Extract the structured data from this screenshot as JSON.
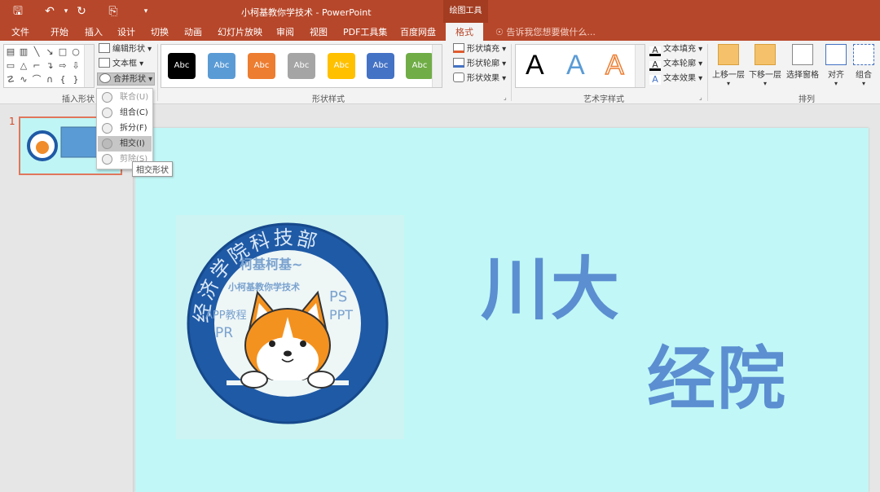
{
  "window": {
    "title": "小柯基教你学技术 - PowerPoint",
    "tools_label": "绘图工具"
  },
  "tabs": [
    "文件",
    "开始",
    "插入",
    "设计",
    "切换",
    "动画",
    "幻灯片放映",
    "审阅",
    "视图",
    "PDF工具集",
    "百度网盘",
    "格式"
  ],
  "tell_me": "告诉我您想要做什么...",
  "ribbon": {
    "insert_shapes": {
      "label": "插入形状",
      "edit_shape": "编辑形状",
      "text_box": "文本框",
      "merge_shapes": "合并形状"
    },
    "shape_styles": {
      "label": "形状样式",
      "swatch_text": "Abc",
      "swatch_colors": [
        "#000000",
        "#5b9bd5",
        "#ed7d31",
        "#a5a5a5",
        "#ffc000",
        "#4472c4",
        "#70ad47"
      ],
      "fill": "形状填充",
      "outline": "形状轮廓",
      "effects": "形状效果"
    },
    "wordart_styles": {
      "label": "艺术字样式",
      "letter": "A",
      "text_fill": "文本填充",
      "text_outline": "文本轮廓",
      "text_effects": "文本效果"
    },
    "arrange": {
      "label": "排列",
      "bring_forward": "上移一层",
      "send_backward": "下移一层",
      "selection_pane": "选择窗格",
      "align": "对齐",
      "group": "组合"
    }
  },
  "merge_menu": {
    "items": [
      "联合(U)",
      "组合(C)",
      "拆分(F)",
      "相交(I)",
      "剪除(S)"
    ],
    "highlighted_index": 3,
    "tooltip": "相交形状"
  },
  "slides_panel": {
    "slide_number": "1"
  },
  "slide": {
    "text1": "川大",
    "text2": "经院",
    "logo": {
      "top_arc": "经济学院科技部",
      "tag_line1": "柯基柯基~",
      "tag_line2": "小柯基教你学技术",
      "left_tags": [
        "APP教程",
        "PR"
      ],
      "right_tags": [
        "PS",
        "PPT"
      ]
    }
  },
  "colors": {
    "accent": "#b7472a",
    "slide_bg": "#c1f7f6",
    "text_blue": "#5b8fd1",
    "logo_ring": "#1f5aa6"
  }
}
